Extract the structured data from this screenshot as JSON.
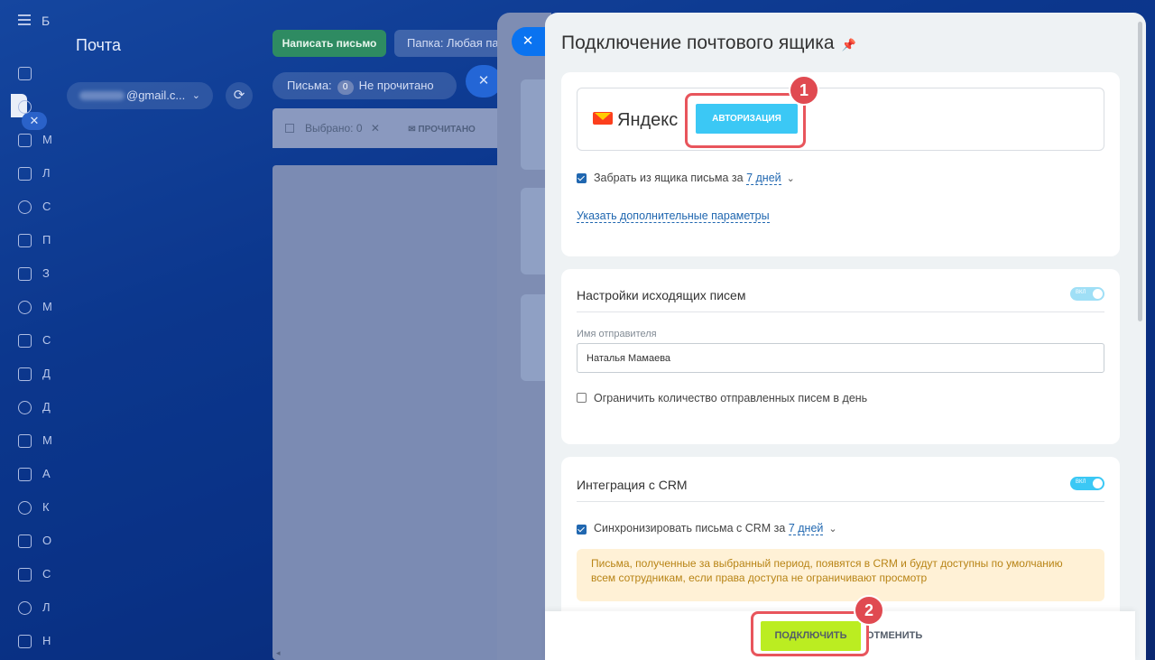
{
  "sidebar": {
    "brand_letter": "Б",
    "items": [
      {
        "icon": "pulse-icon",
        "letter": ""
      },
      {
        "icon": "inbox-icon",
        "letter": ""
      },
      {
        "icon": "messenger-icon",
        "letter": "М"
      },
      {
        "icon": "document-icon",
        "letter": "Л"
      },
      {
        "icon": "funnel-icon",
        "letter": "С"
      },
      {
        "icon": "mail-icon",
        "letter": "П"
      },
      {
        "icon": "task-icon",
        "letter": "З"
      },
      {
        "icon": "target-icon",
        "letter": "М"
      },
      {
        "icon": "sites-icon",
        "letter": "С"
      },
      {
        "icon": "docs-icon",
        "letter": "Д"
      },
      {
        "icon": "storage-icon",
        "letter": "Д"
      },
      {
        "icon": "chat-icon",
        "letter": "М"
      },
      {
        "icon": "robot-icon",
        "letter": "А"
      },
      {
        "icon": "calendar-icon",
        "letter": "К"
      },
      {
        "icon": "schedule-icon",
        "letter": "О"
      },
      {
        "icon": "store-icon",
        "letter": "С"
      },
      {
        "icon": "grid-icon",
        "letter": "Л"
      },
      {
        "icon": "settings-icon",
        "letter": "Н"
      }
    ],
    "close_badge": "✕"
  },
  "mail": {
    "title": "Почта",
    "account": "@gmail.c...",
    "compose_label": "Написать письмо",
    "folder_label": "Папка: Любая папка",
    "filter_label": "Письма:",
    "filter_count": "0",
    "filter_value": "Не прочитано",
    "selected_label": "Выбрано: 0",
    "read_label": "ПРОЧИТАНО"
  },
  "panel": {
    "title": "Подключение почтового ящика",
    "provider_name": "Яндекс",
    "auth_button": "АВТОРИЗАЦИЯ",
    "fetch_label": "Забрать из ящика письма за",
    "fetch_period": "7 дней",
    "extra_params_link": "Указать дополнительные параметры",
    "outgoing": {
      "title": "Настройки исходящих писем",
      "sender_label": "Имя отправителя",
      "sender_value": "Наталья Мамаева",
      "limit_label": "Ограничить количество отправленных писем в день"
    },
    "crm": {
      "title": "Интеграция с CRM",
      "sync_label": "Синхронизировать письма с CRM за",
      "sync_period": "7 дней",
      "warning": "Письма, полученные за выбранный период, появятся в CRM и будут доступны по умолчанию всем сотрудникам, если права доступа не ограничивают просмотр"
    },
    "toggle_text": "ВКЛ",
    "connect_button": "ПОДКЛЮЧИТЬ",
    "cancel_button": "ОТМЕНИТЬ"
  },
  "callouts": {
    "first": "1",
    "second": "2"
  },
  "colors": {
    "accent_blue": "#3bc8f5",
    "connect_green": "#bbed21",
    "callout_red": "#e04a51",
    "link_blue": "#2067b0"
  }
}
